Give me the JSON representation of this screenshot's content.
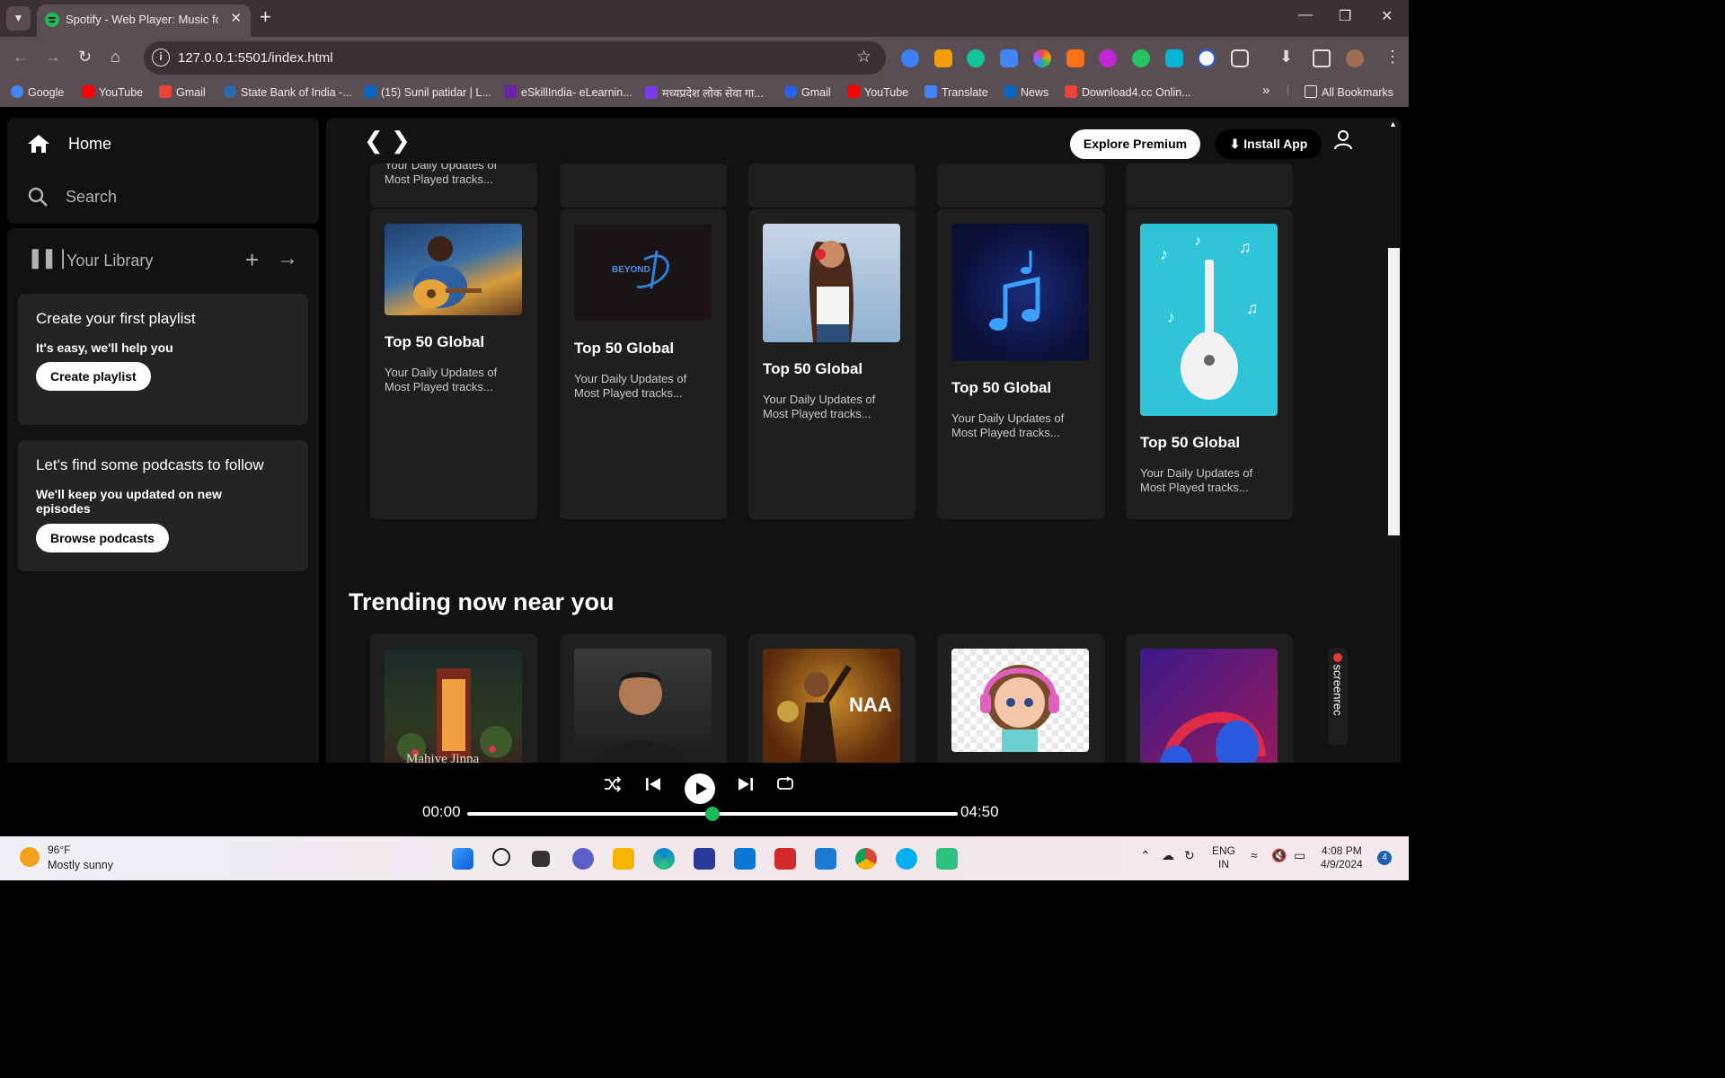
{
  "browser": {
    "tab_title": "Spotify - Web Player: Music for",
    "url": "127.0.0.1:5501/index.html",
    "bookmarks": [
      {
        "label": "Google",
        "color": "#4285f4"
      },
      {
        "label": "YouTube",
        "color": "#ff0000"
      },
      {
        "label": "Gmail",
        "color": "#ea4335"
      },
      {
        "label": "State Bank of India -...",
        "color": "#2b6cb0"
      },
      {
        "label": "(15) Sunil patidar | L...",
        "color": "#0a66c2"
      },
      {
        "label": "eSkillIndia- eLearnin...",
        "color": "#6b21a8"
      },
      {
        "label": "मध्यप्रदेश लोक सेवा गा...",
        "color": "#7c3aed"
      },
      {
        "label": "Gmail",
        "color": "#2563eb"
      },
      {
        "label": "YouTube",
        "color": "#ff0000"
      },
      {
        "label": "Translate",
        "color": "#4285f4"
      },
      {
        "label": "News",
        "color": "#0a66c2"
      },
      {
        "label": "Download4.cc Onlin...",
        "color": "#ea4335"
      }
    ],
    "all_bookmarks": "All Bookmarks"
  },
  "sidebar": {
    "home": "Home",
    "search": "Search",
    "library": "Your Library",
    "playlist_card": {
      "title": "Create your first playlist",
      "text": "It's easy, we'll help you",
      "button": "Create playlist"
    },
    "podcast_card": {
      "title": "Let's find some podcasts to follow",
      "text": "We'll keep you updated on new episodes",
      "button": "Browse podcasts"
    }
  },
  "header": {
    "explore_premium": "Explore Premium",
    "install_app": "Install App"
  },
  "top_row_stub": {
    "text": "Your Daily Updates of Most Played tracks..."
  },
  "cards": [
    {
      "title": "Top 50 Global",
      "subtitle": "Your Daily Updates of Most Played tracks..."
    },
    {
      "title": "Top 50 Global",
      "subtitle": "Your Daily Updates of Most Played tracks..."
    },
    {
      "title": "Top 50 Global",
      "subtitle": "Your Daily Updates of Most Played tracks..."
    },
    {
      "title": "Top 50 Global",
      "subtitle": "Your Daily Updates of Most Played tracks..."
    },
    {
      "title": "Top 50 Global",
      "subtitle": "Your Daily Updates of Most Played tracks..."
    }
  ],
  "card_logo_text": "BEYOND",
  "trending": {
    "title": "Trending now near you",
    "first_cover_text": "Mahiye Jinna"
  },
  "screenrec": "screenrec",
  "player": {
    "current_time": "00:00",
    "total_time": "04:50",
    "progress": 0.5,
    "accent": "#1db954"
  },
  "taskbar": {
    "temp": "96°F",
    "weather": "Mostly sunny",
    "lang": "ENG",
    "region": "IN",
    "time": "4:08 PM",
    "date": "4/9/2024",
    "notifications": "4"
  }
}
